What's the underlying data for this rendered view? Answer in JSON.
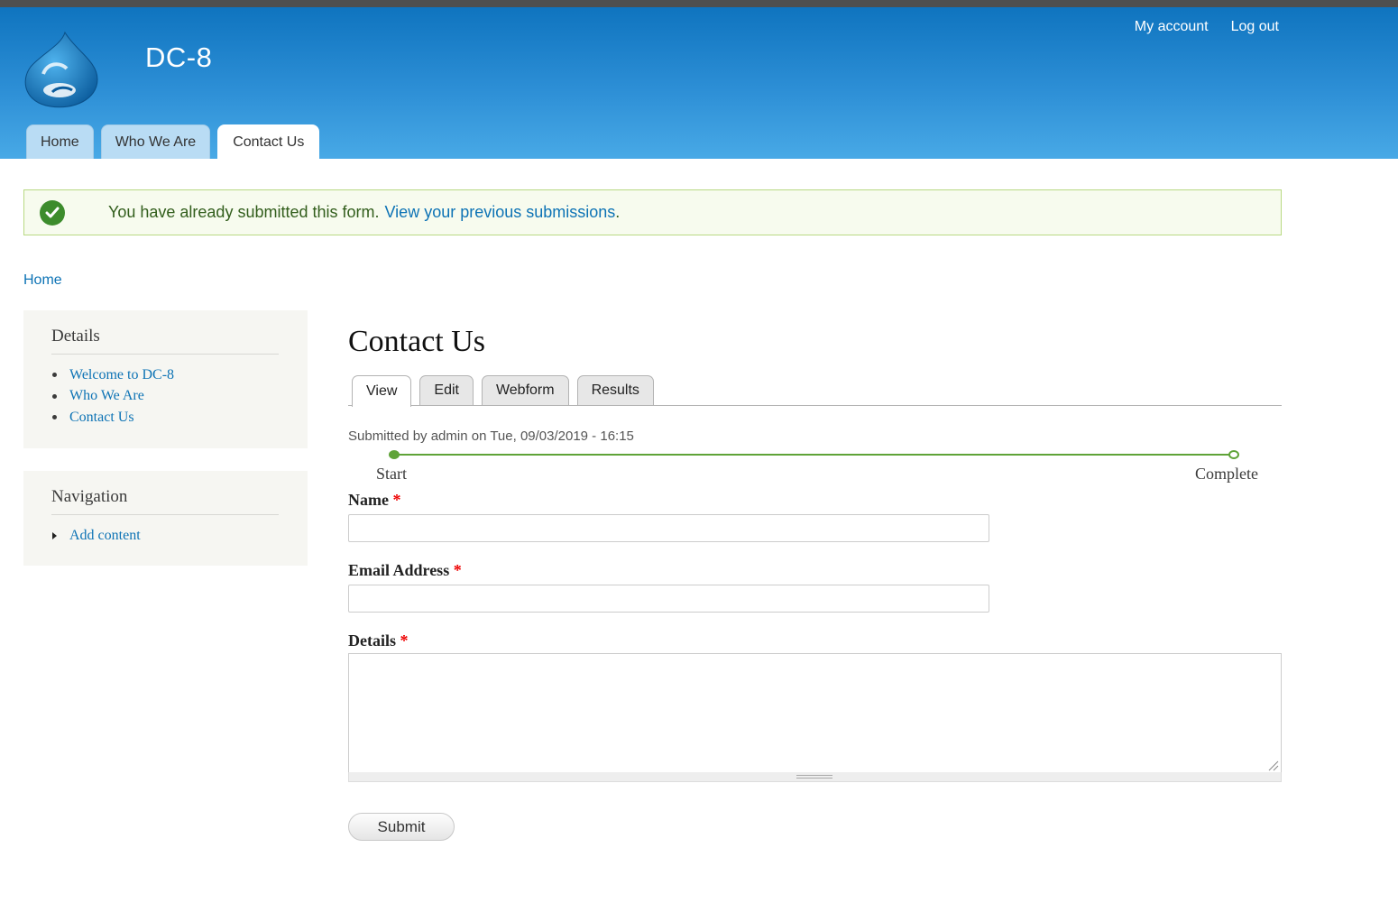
{
  "site": {
    "name": "DC-8"
  },
  "secondary_menu": {
    "my_account": "My account",
    "log_out": "Log out"
  },
  "primary_tabs": [
    {
      "label": "Home"
    },
    {
      "label": "Who We Are"
    },
    {
      "label": "Contact Us",
      "active": true
    }
  ],
  "status_message": {
    "text": "You have already submitted this form.",
    "link": "View your previous submissions",
    "suffix": "."
  },
  "breadcrumb": {
    "home": "Home"
  },
  "sidebar": {
    "details": {
      "title": "Details",
      "items": [
        {
          "label": "Welcome to DC-8"
        },
        {
          "label": "Who We Are"
        },
        {
          "label": "Contact Us"
        }
      ]
    },
    "navigation": {
      "title": "Navigation",
      "items": [
        {
          "label": "Add content"
        }
      ]
    }
  },
  "main": {
    "title": "Contact Us",
    "local_tabs": [
      {
        "label": "View",
        "active": true
      },
      {
        "label": "Edit"
      },
      {
        "label": "Webform"
      },
      {
        "label": "Results"
      }
    ],
    "submitted": "Submitted by admin on Tue, 09/03/2019 - 16:15",
    "progress": {
      "start": "Start",
      "end": "Complete"
    },
    "form": {
      "name_label": "Name",
      "name_value": "",
      "email_label": "Email Address",
      "email_value": "",
      "details_label": "Details",
      "details_value": "",
      "required_marker": "*",
      "submit_label": "Submit"
    }
  },
  "colors": {
    "header_top": "#0f74bf",
    "header_bottom": "#48a9e6",
    "link": "#0d73b5",
    "success_border": "#b8d983",
    "success_bg": "#f7fbee",
    "progress": "#5fa338",
    "required": "#ee0000"
  },
  "icons": {
    "logo": "drupal-drop-logo",
    "status": "check-circle-icon",
    "resize": "resize-handle-icon"
  }
}
